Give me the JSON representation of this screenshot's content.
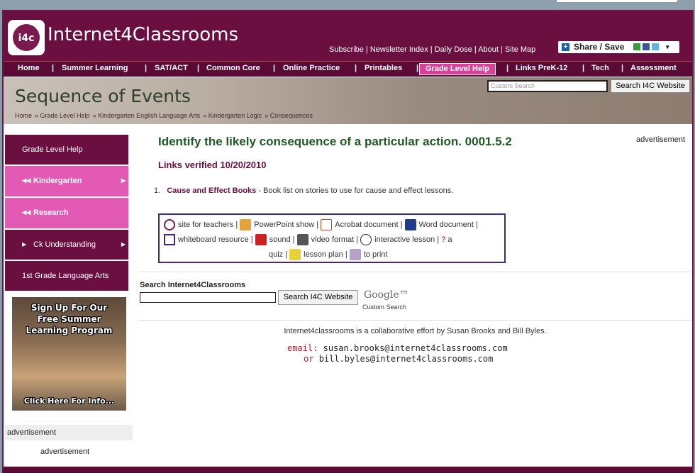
{
  "header": {
    "logo_text": "Internet4Classrooms",
    "logo_badge": "i4c",
    "top_links": [
      "Subscribe",
      "Newsletter Index",
      "Daily Dose",
      "About",
      "Site Map"
    ],
    "share_label": "Share / Save"
  },
  "nav": [
    "Home",
    "Summer Learning",
    "SAT/ACT",
    "Common Core",
    "Online Practice",
    "Printables",
    "Grade Level Help",
    "Links PreK-12",
    "Tech",
    "Assessment"
  ],
  "banner": {
    "title": "Sequence of Events",
    "breadcrumbs": [
      "Home",
      "Grade Level Help",
      "Kindergarten English Language Arts",
      "Kindergarten Logic",
      "Consequences"
    ],
    "search_placeholder": "Custom Search",
    "search_button": "Search I4C Website"
  },
  "sidebar": {
    "items": [
      {
        "label": "Grade Level Help"
      },
      {
        "label": "Kindergarten"
      },
      {
        "label": "Research"
      },
      {
        "label": "Ck Understanding"
      },
      {
        "label": "1st Grade Language Arts"
      }
    ],
    "promo_lines": [
      "Sign Up For Our",
      "Free Summer",
      "Learning Program",
      "Click Here For Info..."
    ],
    "ad_label": "advertisement",
    "ad_label2": "advertisement"
  },
  "main": {
    "heading": "Identify the likely consequence of a particular action. 0001.5.2",
    "ad_label": "advertisement",
    "verified": "Links verified 10/20/2010",
    "list_num": "1.",
    "link_title": "Cause and Effect Books",
    "link_desc": " - Book list on stories to use for cause and effect lessons.",
    "legend": {
      "teachers": "site for teachers",
      "ppt": "PowerPoint show",
      "acrobat": "Acrobat document",
      "word": "Word document",
      "whiteboard": "whiteboard resource",
      "sound": "sound",
      "video": "video format",
      "interactive": "interactive lesson",
      "a": "a",
      "quiz": "quiz",
      "lesson": "lesson plan",
      "print": "to print"
    },
    "search_label": "Search Internet4Classrooms",
    "search_button": "Search I4C Website",
    "google_text": "Google™",
    "google_sub": "Custom Search",
    "collab_text": "Internet4classrooms is a collaborative effort by Susan Brooks and Bill Byles.",
    "email_label": "email:",
    "email1": "susan.brooks@internet4classrooms.com",
    "or_label": "or",
    "email2": "bill.byles@internet4classrooms.com"
  }
}
